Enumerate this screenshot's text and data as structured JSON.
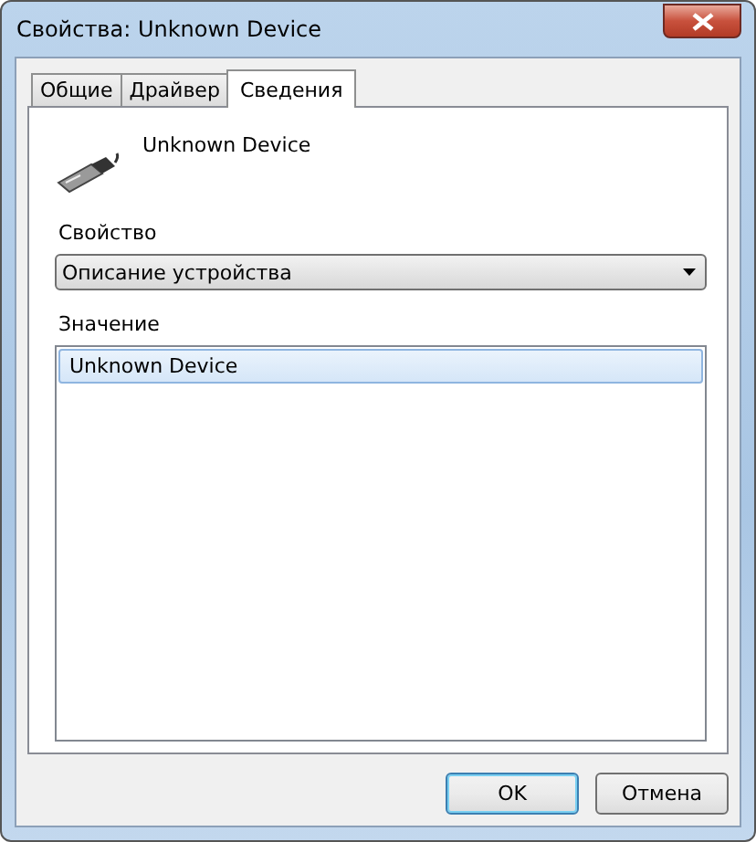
{
  "window": {
    "title": "Свойства: Unknown Device"
  },
  "tabs": [
    {
      "label": "Общие",
      "selected": false
    },
    {
      "label": "Драйвер",
      "selected": false
    },
    {
      "label": "Сведения",
      "selected": true
    }
  ],
  "device_name": "Unknown Device",
  "property": {
    "label": "Свойство",
    "value": "Описание устройства"
  },
  "value": {
    "label": "Значение",
    "items": [
      {
        "text": "Unknown Device",
        "selected": true
      }
    ]
  },
  "buttons": [
    {
      "label": "OK",
      "default": true
    },
    {
      "label": "Отмена",
      "default": false
    }
  ]
}
